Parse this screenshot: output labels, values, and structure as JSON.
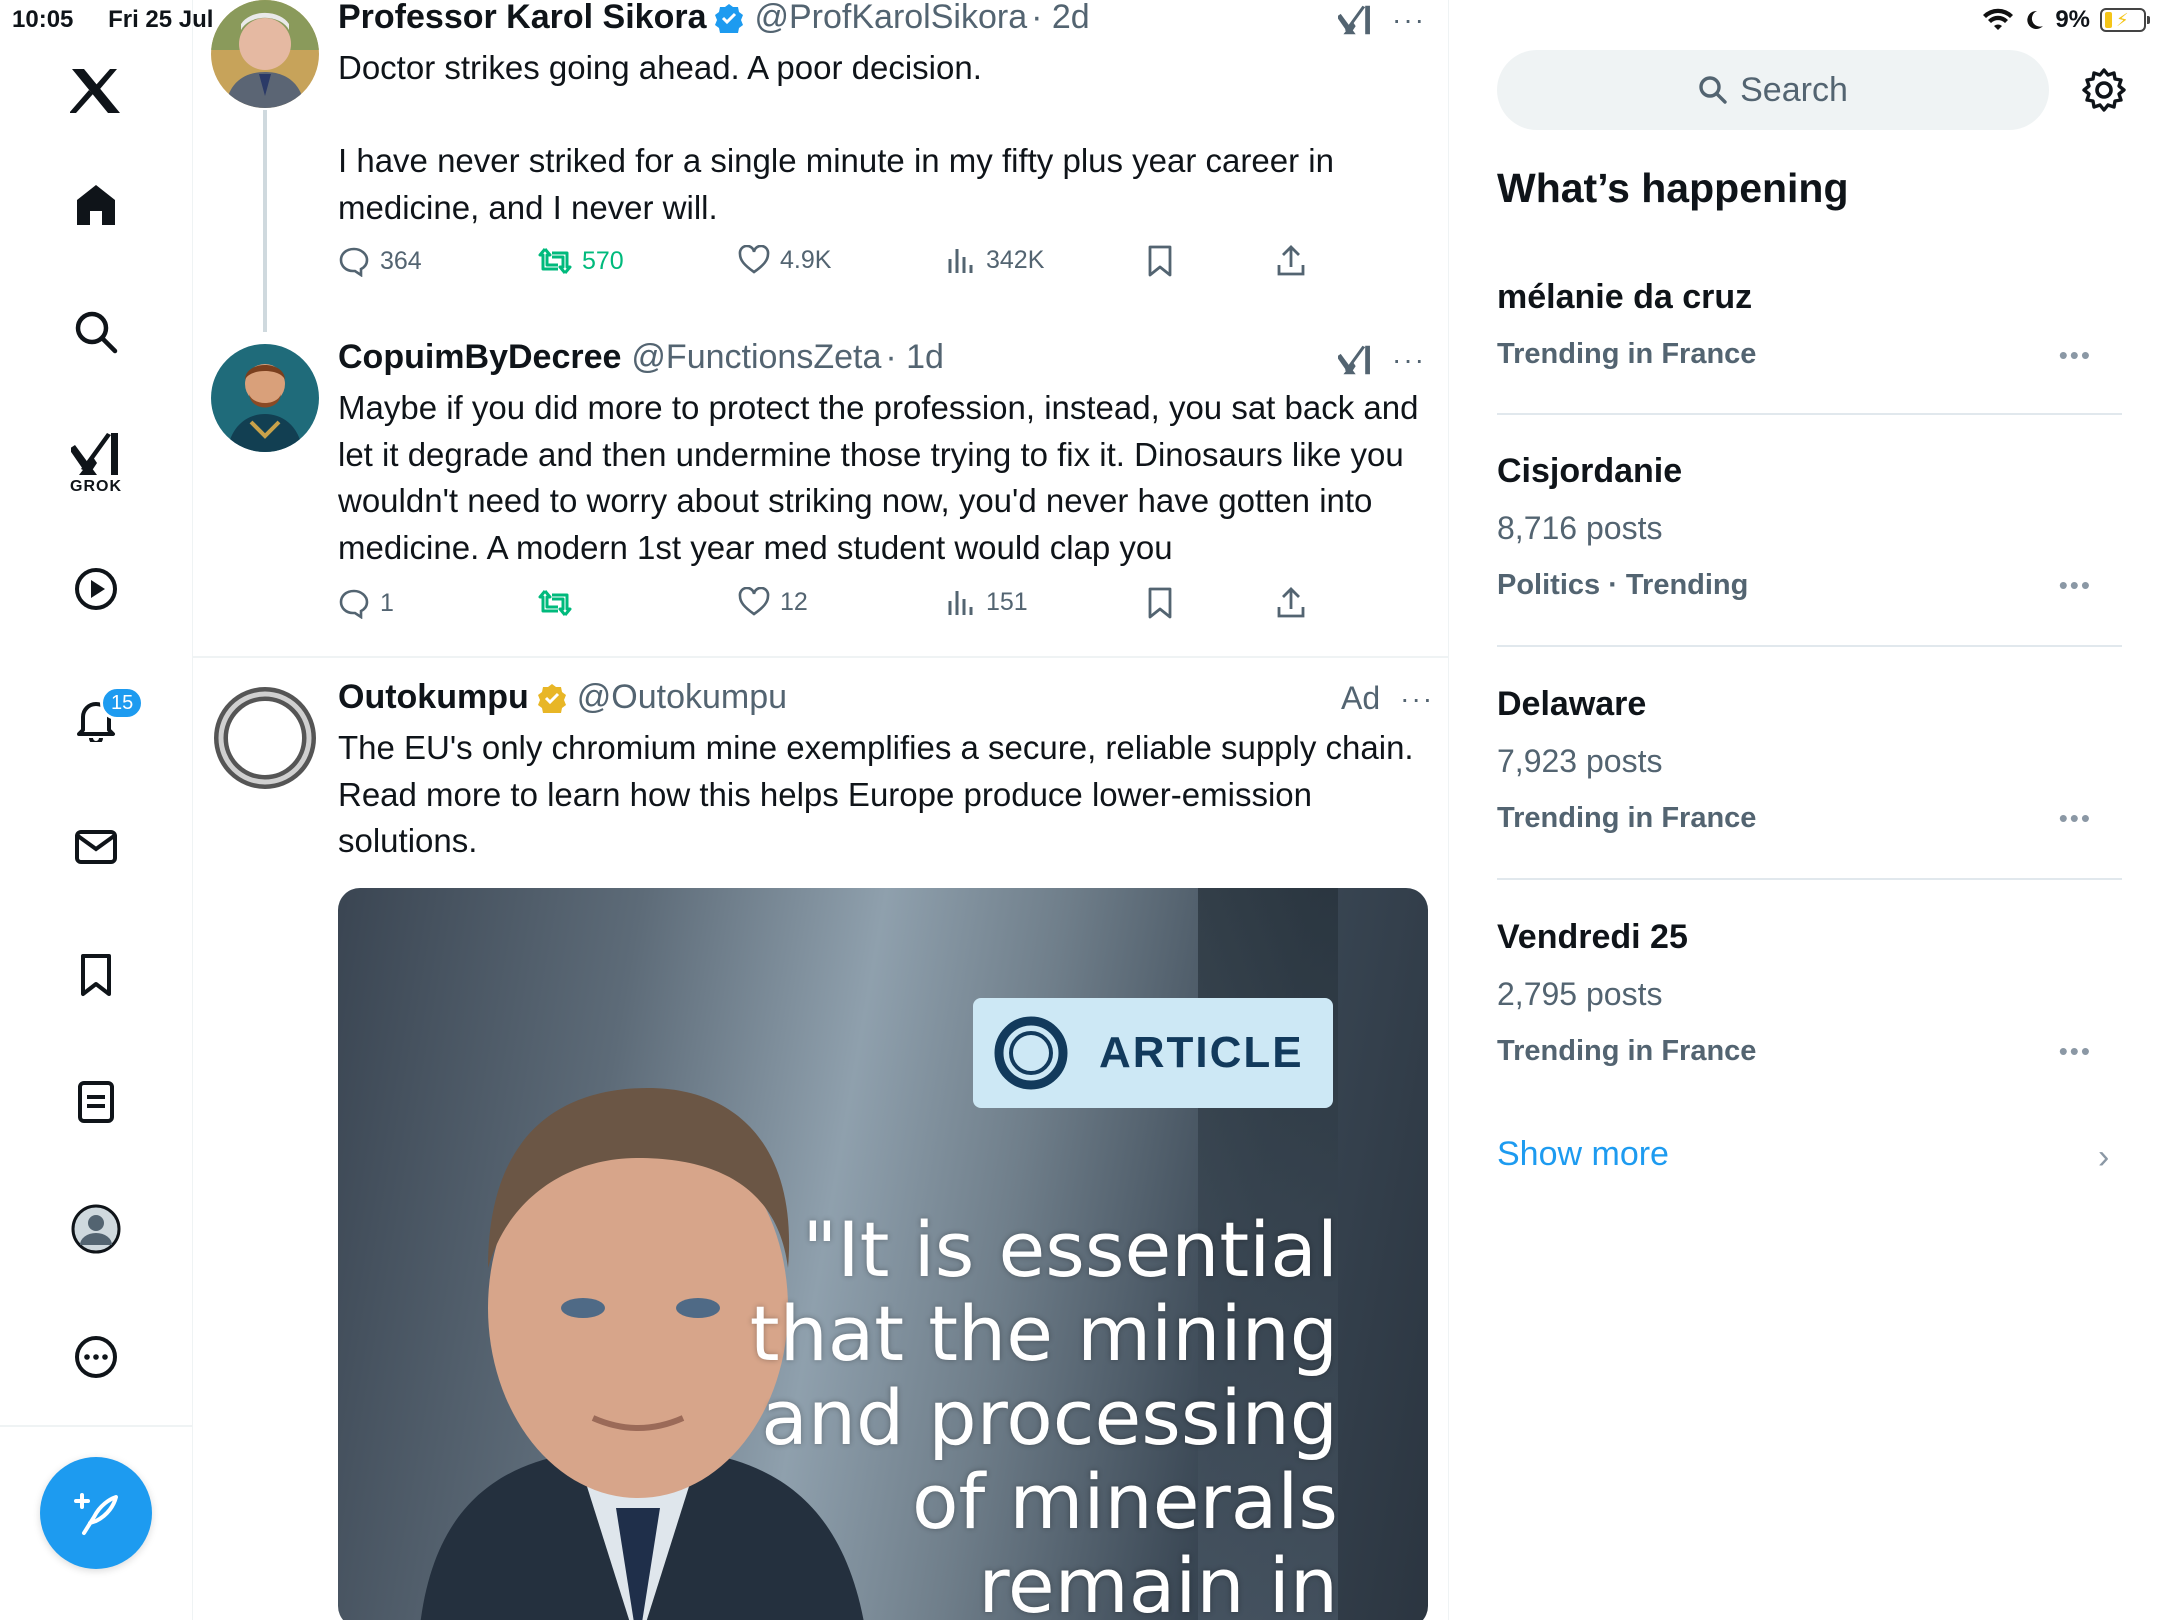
{
  "status_bar": {
    "time": "10:05",
    "date": "Fri 25 Jul",
    "battery": "9%"
  },
  "nav": {
    "grok_label": "GROK",
    "notifications_badge": "15",
    "icons": [
      "x-logo-icon",
      "home-icon",
      "search-icon",
      "grok-icon",
      "video-icon",
      "notifications-icon",
      "messages-icon",
      "bookmarks-icon",
      "lists-icon",
      "profile-icon",
      "more-icon",
      "compose-icon"
    ]
  },
  "tweets": [
    {
      "name": "Professor Karol Sikora",
      "handle": "@ProfKarolSikora",
      "time": "· 2d",
      "text": "Doctor strikes going ahead. A poor decision.\n\nI have never striked for a single minute in my fifty plus year career in medicine, and I never will.",
      "replies": "364",
      "reposts": "570",
      "likes": "4.9K",
      "views": "342K"
    },
    {
      "name": "CopuimByDecree",
      "handle": "@FunctionsZeta",
      "time": "· 1d",
      "text": "Maybe if you did more to protect the profession, instead, you sat back and let it degrade and then undermine those trying to fix it. Dinosaurs like you wouldn't need to worry about striking now, you'd never have gotten into medicine. A modern 1st year med student would clap you",
      "replies": "1",
      "reposts": "",
      "likes": "12",
      "views": "151"
    },
    {
      "name": "Outokumpu",
      "handle": "@Outokumpu",
      "ad_label": "Ad",
      "text": "The EU's only chromium mine exemplifies a secure, reliable supply chain. Read more to learn how this helps Europe produce lower-emission solutions.",
      "image": {
        "badge": "ARTICLE",
        "quote": "\"It is essential that the mining and processing of minerals remain in"
      }
    }
  ],
  "sidebar": {
    "search_placeholder": "Search",
    "heading": "What’s happening",
    "trends": [
      {
        "name": "mélanie da cruz",
        "posts": "",
        "context": "Trending in France"
      },
      {
        "name": "Cisjordanie",
        "posts": "8,716 posts",
        "context": "Politics · Trending"
      },
      {
        "name": "Delaware",
        "posts": "7,923 posts",
        "context": "Trending in France"
      },
      {
        "name": "Vendredi 25",
        "posts": "2,795 posts",
        "context": "Trending in France"
      }
    ],
    "show_more": "Show more"
  },
  "colors": {
    "accent": "#1d9bf0",
    "repost_green": "#00ba7c",
    "muted_text": "#536471",
    "verified_gold": "#e8b626"
  }
}
